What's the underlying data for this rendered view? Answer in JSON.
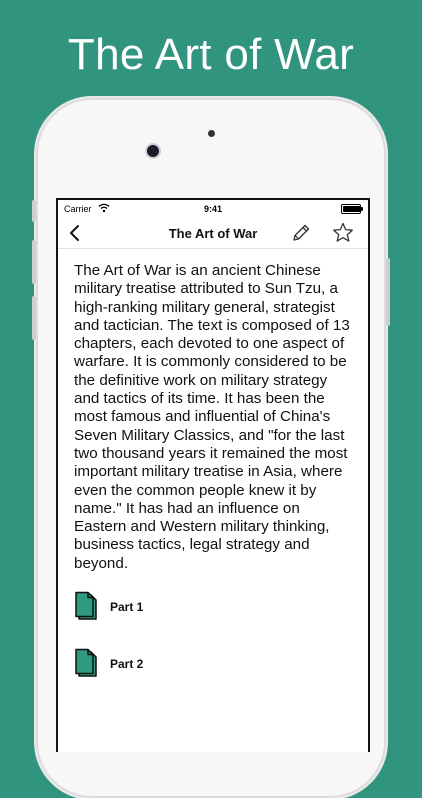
{
  "headline": "The Art of War",
  "status_bar": {
    "carrier": "Carrier",
    "time": "9:41"
  },
  "nav": {
    "title": "The Art of War",
    "back_icon": "chevron-left-icon",
    "edit_icon": "pencil-icon",
    "favorite_icon": "star-icon"
  },
  "description": "The Art of War is an ancient Chinese military treatise attributed to Sun Tzu, a high-ranking military general, strategist and tactician. The text is composed of 13 chapters, each devoted to one aspect of warfare. It is commonly considered to be the definitive work on military strategy and tactics of its time. It has been the most famous and influential of China's Seven Military Classics, and \"for the last two thousand years it remained the most important military treatise in Asia, where even the common people knew it by name.\" It has had an influence on Eastern and Western military thinking, business tactics, legal strategy and beyond.",
  "parts": [
    {
      "label": "Part 1",
      "icon": "document-icon"
    },
    {
      "label": "Part 2",
      "icon": "document-icon"
    }
  ],
  "colors": {
    "background": "#31947f",
    "accent": "#2e9a7f"
  }
}
